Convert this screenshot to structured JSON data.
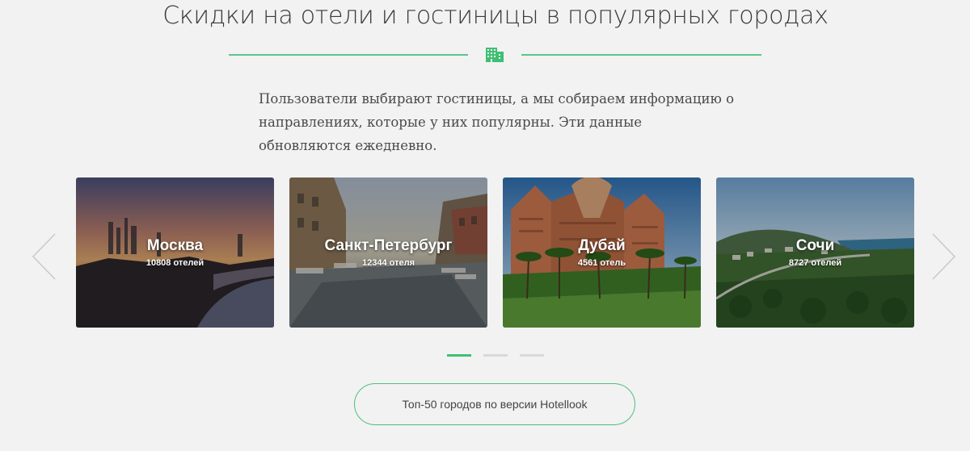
{
  "section": {
    "title": "Скидки на отели и гостиницы в популярных городах",
    "description": "Пользователи выбирают гостиницы, а мы собираем информацию о направлениях, которые у них популярны. Эти данные обновляются ежедневно.",
    "divider_icon": "hotel-building-icon",
    "accent_color": "#3fbf73"
  },
  "carousel": {
    "prev_icon": "chevron-left-icon",
    "next_icon": "chevron-right-icon",
    "cards": [
      {
        "city": "Москва",
        "count": "10808 отелей"
      },
      {
        "city": "Санкт-Петербург",
        "count": "12344 отеля"
      },
      {
        "city": "Дубай",
        "count": "4561 отель"
      },
      {
        "city": "Сочи",
        "count": "8727 отелей"
      }
    ],
    "pages": 3,
    "active_page": 1
  },
  "cta": {
    "label": "Топ-50 городов по версии Hotellook"
  }
}
